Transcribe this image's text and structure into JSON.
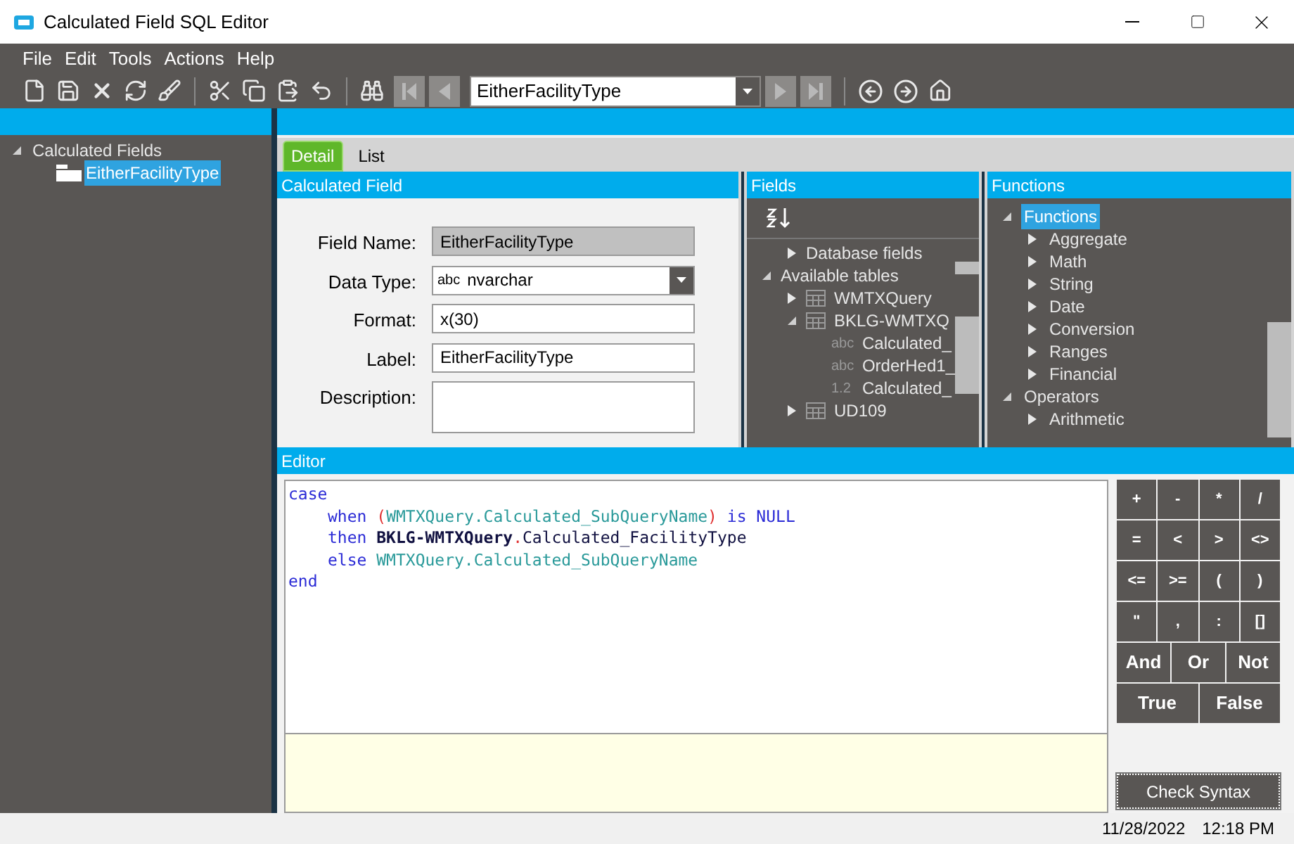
{
  "window": {
    "title": "Calculated Field SQL Editor"
  },
  "menu": [
    "File",
    "Edit",
    "Tools",
    "Actions",
    "Help"
  ],
  "toolbar": {
    "record_selector": "EitherFacilityType"
  },
  "left_tree": [
    {
      "label": "Calculated Fields",
      "expanded": true,
      "selected": false,
      "children": [
        {
          "label": "EitherFacilityType",
          "selected": true
        }
      ]
    }
  ],
  "tabs": [
    {
      "label": "Detail",
      "selected": true
    },
    {
      "label": "List",
      "selected": false
    }
  ],
  "calculated_field": {
    "title": "Calculated Field",
    "fields": [
      {
        "label": "Field Name:",
        "kind": "readonly",
        "value": "EitherFacilityType"
      },
      {
        "label": "Data Type:",
        "kind": "dropdown",
        "prefix": "abc",
        "value": "nvarchar"
      },
      {
        "label": "Format:",
        "kind": "text",
        "value": "x(30)"
      },
      {
        "label": "Label:",
        "kind": "text",
        "value": "EitherFacilityType"
      },
      {
        "label": "Description:",
        "kind": "multiline"
      }
    ]
  },
  "fields_panel": {
    "title": "Fields",
    "tree": [
      {
        "label": "Database fields",
        "expanded": false
      },
      {
        "label": "Available tables",
        "expanded": true,
        "children": [
          {
            "label": "WMTXQuery",
            "kind": "table",
            "expanded": false
          },
          {
            "label": "BKLG-WMTXQ",
            "kind": "table",
            "expanded": true,
            "children": [
              {
                "label": "Calculated_",
                "kind": "field",
                "type": "abc"
              },
              {
                "label": "OrderHed1_",
                "kind": "field",
                "type": "abc"
              },
              {
                "label": "Calculated_",
                "kind": "field",
                "type": "1.2"
              }
            ]
          },
          {
            "label": "UD109",
            "kind": "table",
            "expanded": false
          }
        ]
      }
    ]
  },
  "functions_panel": {
    "title": "Functions",
    "tree": [
      {
        "label": "Functions",
        "expanded": true,
        "selected": true,
        "children": [
          {
            "label": "Aggregate",
            "expanded": false,
            "selected": false
          },
          {
            "label": "Math",
            "expanded": false,
            "selected": false
          },
          {
            "label": "String",
            "expanded": false,
            "selected": false
          },
          {
            "label": "Date",
            "expanded": false,
            "selected": false
          },
          {
            "label": "Conversion",
            "expanded": false,
            "selected": false
          },
          {
            "label": "Ranges",
            "expanded": false,
            "selected": false
          },
          {
            "label": "Financial",
            "expanded": false,
            "selected": false
          }
        ]
      },
      {
        "label": "Operators",
        "expanded": true,
        "selected": false,
        "children": [
          {
            "label": "Arithmetic",
            "expanded": false,
            "selected": false
          }
        ]
      }
    ]
  },
  "editor": {
    "title": "Editor",
    "lines": [
      {
        "indent": false,
        "tokens": [
          {
            "text": "case",
            "kind": "keyword"
          }
        ]
      },
      {
        "indent": true,
        "tokens": [
          {
            "text": "when ",
            "kind": "keyword"
          },
          {
            "text": "(",
            "kind": "paren"
          },
          {
            "text": "WMTXQuery.Calculated_SubQueryName",
            "kind": "reference"
          },
          {
            "text": ")",
            "kind": "paren"
          },
          {
            "text": " is NULL",
            "kind": "keyword"
          }
        ]
      },
      {
        "indent": true,
        "tokens": [
          {
            "text": "then ",
            "kind": "keyword"
          },
          {
            "text": "BKLG-WMTXQuery",
            "kind": "table"
          },
          {
            "text": ".",
            "kind": "paren"
          },
          {
            "text": "Calculated_FacilityType",
            "kind": "name"
          }
        ]
      },
      {
        "indent": true,
        "tokens": [
          {
            "text": "else ",
            "kind": "keyword"
          },
          {
            "text": "WMTXQuery.Calculated_SubQueryName",
            "kind": "reference"
          }
        ]
      },
      {
        "indent": false,
        "tokens": [
          {
            "text": "end",
            "kind": "keyword"
          }
        ]
      }
    ]
  },
  "keypad": [
    [
      "+",
      "-",
      "*",
      "/"
    ],
    [
      "=",
      "<",
      ">",
      "<>"
    ],
    [
      "<=",
      ">=",
      "(",
      ")"
    ],
    [
      "\"",
      ",",
      ":",
      "[]"
    ],
    [
      "And",
      "Or",
      "Not"
    ],
    [
      "True",
      "False"
    ]
  ],
  "check_syntax_button": "Check Syntax",
  "status_bar": {
    "date": "11/28/2022",
    "time": "12:18 PM"
  }
}
